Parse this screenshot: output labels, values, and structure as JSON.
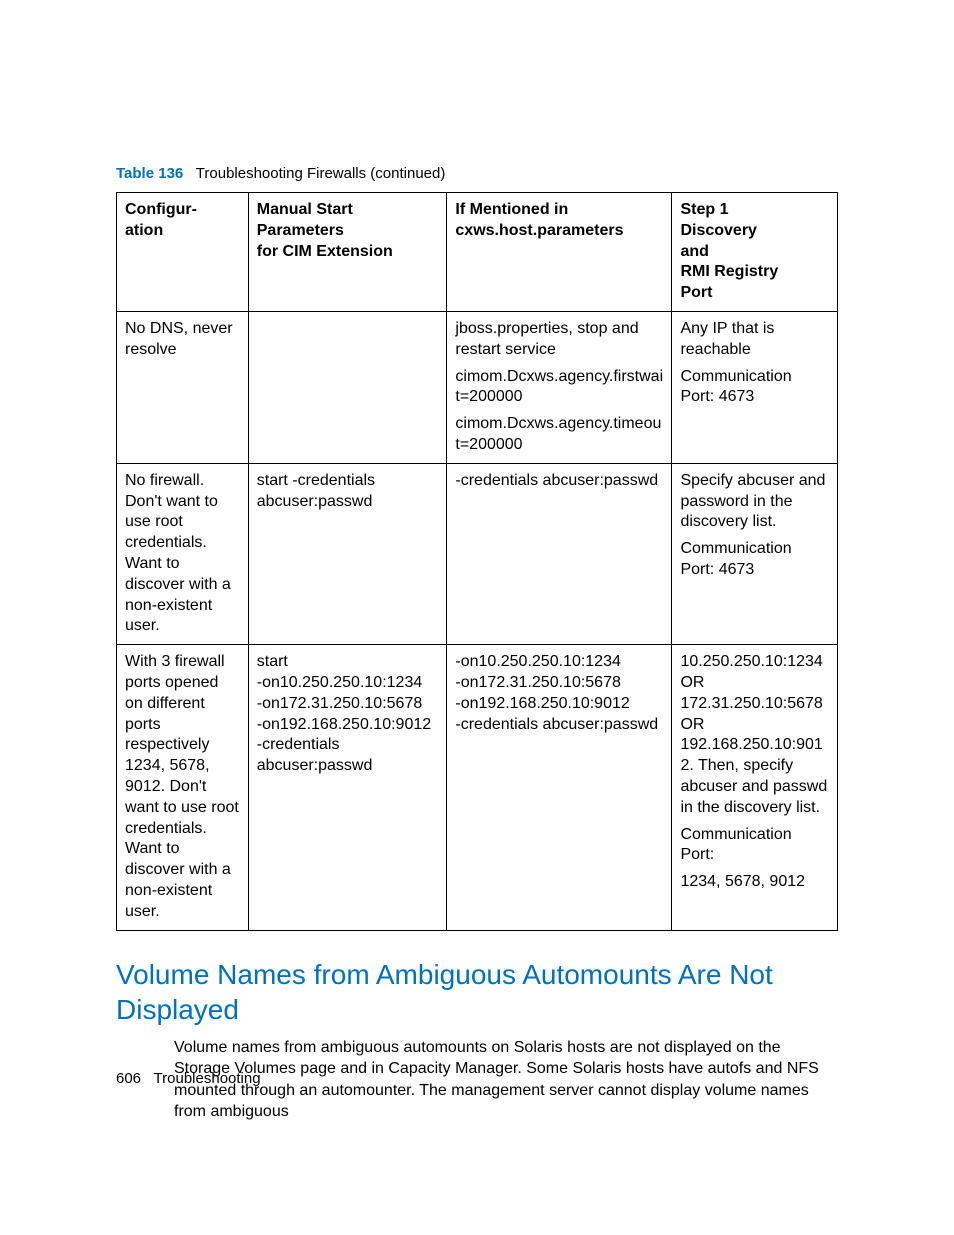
{
  "caption": {
    "label": "Table 136",
    "text": "Troubleshooting Firewalls (continued)"
  },
  "headers": {
    "c1a": "Configur-",
    "c1b": "ation",
    "c2a": "Manual Start",
    "c2b": "Parameters",
    "c2c": "for CIM Extension",
    "c3a": "If Mentioned in",
    "c3b": "cxws.host.parameters",
    "c4a": "Step 1",
    "c4b": "Discovery",
    "c4c": "and",
    "c4d": "RMI Registry",
    "c4e": "Port"
  },
  "rows": [
    {
      "c1": "No DNS, never resolve",
      "c2": "",
      "c3": [
        "jboss.properties, stop and restart service",
        "cimom.Dcxws.agency.firstwait=200000",
        "cimom.Dcxws.agency.timeout=200000"
      ],
      "c4": [
        "Any IP that is reachable",
        "Communication Port: 4673"
      ]
    },
    {
      "c1": "No firewall. Don't want to use root credentials. Want to discover with a non-existent user.",
      "c2": "start -credentials abcuser:passwd",
      "c3": [
        "-credentials abcuser:passwd"
      ],
      "c4": [
        "Specify abcuser and password in the discovery list.",
        "Communication Port: 4673"
      ]
    },
    {
      "c1": "With 3 firewall ports opened on different ports respectively 1234, 5678, 9012. Don't want to use root credentials. Want to discover with a non-existent user.",
      "c2": "start\n-on10.250.250.10:1234\n-on172.31.250.10:5678\n-on192.168.250.10:9012\n-credentials abcuser:passwd",
      "c3": [
        "-on10.250.250.10:1234",
        "-on172.31.250.10:5678",
        "-on192.168.250.10:9012",
        "-credentials abcuser:passwd"
      ],
      "c4": [
        "10.250.250.10:1234 OR 172.31.250.10:5678 OR 192.168.250.10:9012. Then, specify abcuser and passwd in the discovery list.",
        "Communication Port:",
        "1234, 5678, 9012"
      ]
    }
  ],
  "section_heading": "Volume Names from Ambiguous Automounts Are Not Displayed",
  "body": "Volume names from ambiguous automounts on Solaris hosts are not displayed on the Storage Volumes page and in Capacity Manager. Some Solaris hosts have autofs and NFS mounted through an automounter. The management server cannot display volume names from ambiguous",
  "footer": {
    "page": "606",
    "section": "Troubleshooting"
  }
}
